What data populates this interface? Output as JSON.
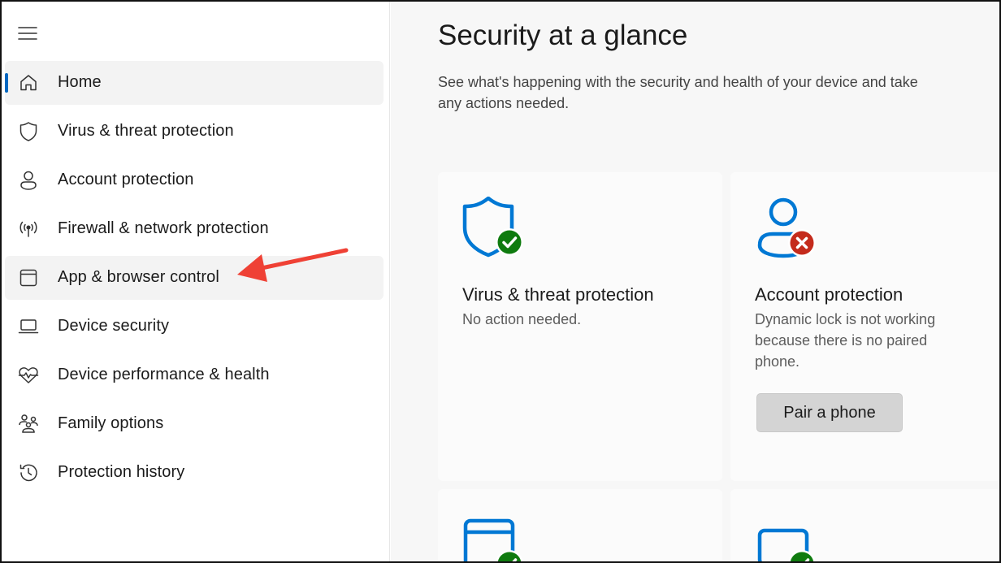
{
  "sidebar": {
    "items": [
      {
        "label": "Home",
        "icon": "home-icon"
      },
      {
        "label": "Virus & threat protection",
        "icon": "shield-icon"
      },
      {
        "label": "Account protection",
        "icon": "person-icon"
      },
      {
        "label": "Firewall & network protection",
        "icon": "antenna-icon"
      },
      {
        "label": "App & browser control",
        "icon": "app-window-icon"
      },
      {
        "label": "Device security",
        "icon": "laptop-icon"
      },
      {
        "label": "Device performance & health",
        "icon": "heart-pulse-icon"
      },
      {
        "label": "Family options",
        "icon": "family-icon"
      },
      {
        "label": "Protection history",
        "icon": "history-icon"
      }
    ],
    "selected_index": 0,
    "hovered_index": 4
  },
  "main": {
    "title": "Security at a glance",
    "description": "See what's happening with the security and health of your device and take any actions needed.",
    "cards": [
      {
        "title": "Virus & threat protection",
        "status": "No action needed.",
        "icon": "shield-check-icon",
        "state": "ok"
      },
      {
        "title": "Account protection",
        "status": "Dynamic lock is not working because there is no paired phone.",
        "icon": "person-error-icon",
        "state": "warning",
        "action_label": "Pair a phone"
      },
      {
        "icon": "app-window-check-icon",
        "state": "ok"
      },
      {
        "icon": "laptop-check-icon",
        "state": "ok"
      }
    ]
  },
  "colors": {
    "accent": "#0067c0",
    "icon_blue": "#0078d4",
    "ok_green": "#0f7b0f",
    "error_red": "#c42b1c",
    "annotation_red": "#ef4135"
  }
}
